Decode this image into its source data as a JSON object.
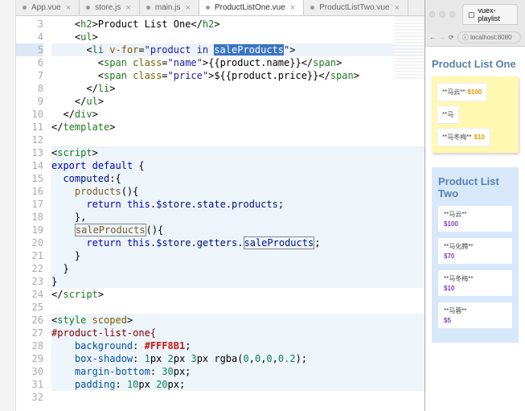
{
  "tabs": [
    {
      "label": "App.vue"
    },
    {
      "label": "store.js"
    },
    {
      "label": "main.js"
    },
    {
      "label": "ProductListOne.vue"
    },
    {
      "label": "ProductListTwo.vue"
    }
  ],
  "activeTab": 3,
  "gutterStart": 3,
  "gutterEnd": 32,
  "highlightLine": 5,
  "code": {
    "l3": {
      "tag": "h2",
      "text": "Product List One"
    },
    "l4": {
      "tag": "ul"
    },
    "l5": {
      "tag": "li",
      "attr": "v-for",
      "val": "product in saleProducts",
      "selected": "saleProducts"
    },
    "l6": {
      "tag": "span",
      "cls": "name",
      "mustache": "{{product.name}}"
    },
    "l7": {
      "tag": "span",
      "cls": "price",
      "prefix": "$",
      "mustache": "{{product.price}}"
    },
    "l8": {
      "close": "li"
    },
    "l9": {
      "close": "ul"
    },
    "l10": {
      "close": "div"
    },
    "l11": {
      "close": "template"
    },
    "l13": {
      "open": "script"
    },
    "l14": "export default {",
    "l15": "computed:{",
    "l16": {
      "fn": "products"
    },
    "l17": {
      "ret": "this.$store.state.products;"
    },
    "l18": "},",
    "l19": {
      "fn": "saleProducts",
      "boxed": true
    },
    "l20": {
      "ret_getters": "saleProducts",
      "boxed": true
    },
    "l21": "}",
    "l22": "}",
    "l23": "}",
    "l24": {
      "close": "script"
    },
    "l26": {
      "open": "style",
      "attr": "scoped"
    },
    "l27": {
      "sel": "#product-list-one{"
    },
    "l28": {
      "prop": "background",
      "val_hex": "#FFF8B1"
    },
    "l29": {
      "prop": "box-shadow",
      "val": "1px 2px 3px rgba(0,0,0,0.2)"
    },
    "l30": {
      "prop": "margin-bottom",
      "val": "30px"
    },
    "l31": {
      "prop": "padding",
      "val": "10px 20px"
    }
  },
  "browser": {
    "tabTitle": "vuex-playlist",
    "url": "localhost:8080",
    "list1": {
      "title": "Product List One",
      "items": [
        {
          "name": "**马云**",
          "price": "$100"
        },
        {
          "name": "**马",
          "price": ""
        },
        {
          "name": "**马冬梅**",
          "price": "$10"
        }
      ]
    },
    "list2": {
      "title": "Product List Two",
      "items": [
        {
          "name": "**马云**",
          "price": "$100"
        },
        {
          "name": "**马化腾**",
          "price": "$70"
        },
        {
          "name": "**马冬梅**",
          "price": "$10"
        },
        {
          "name": "**马蓉**",
          "price": "$5"
        }
      ]
    }
  }
}
